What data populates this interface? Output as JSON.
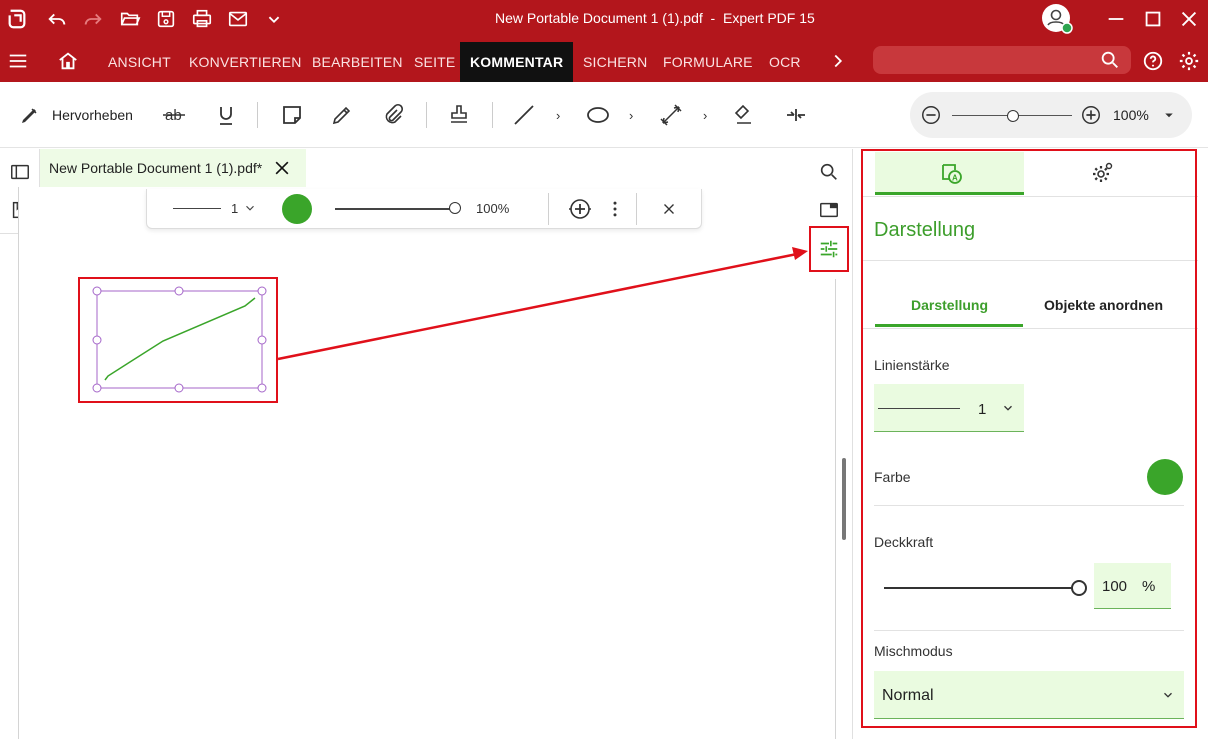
{
  "window": {
    "title": "New Portable Document 1 (1).pdf  -  Expert PDF 15"
  },
  "menu": {
    "items": [
      "ANSICHT",
      "KONVERTIEREN",
      "BEARBEITEN",
      "SEITE",
      "KOMMENTAR",
      "SICHERN",
      "FORMULARE",
      "OCR"
    ],
    "active": "KOMMENTAR",
    "search_placeholder": ""
  },
  "toolbar": {
    "highlight_label": "Hervorheben",
    "zoom_value": "100%"
  },
  "document": {
    "tab_title": "New Portable Document 1 (1).pdf*"
  },
  "floatbar": {
    "line_width": "1",
    "opacity": "100%",
    "color": "#3aa52a"
  },
  "panel": {
    "title": "Darstellung",
    "subtabs": [
      "Darstellung",
      "Objekte anordnen"
    ],
    "active_subtab": "Darstellung",
    "line_width_label": "Linienstärke",
    "line_width_value": "1",
    "color_label": "Farbe",
    "color_value": "#3aa52a",
    "opacity_label": "Deckkraft",
    "opacity_value": "100",
    "opacity_unit": "%",
    "opacity_fraction": 1.0,
    "blend_label": "Mischmodus",
    "blend_value": "Normal"
  },
  "colors": {
    "brand": "#b3161c",
    "accent": "#3aa52a",
    "highlight": "#e0101a"
  }
}
